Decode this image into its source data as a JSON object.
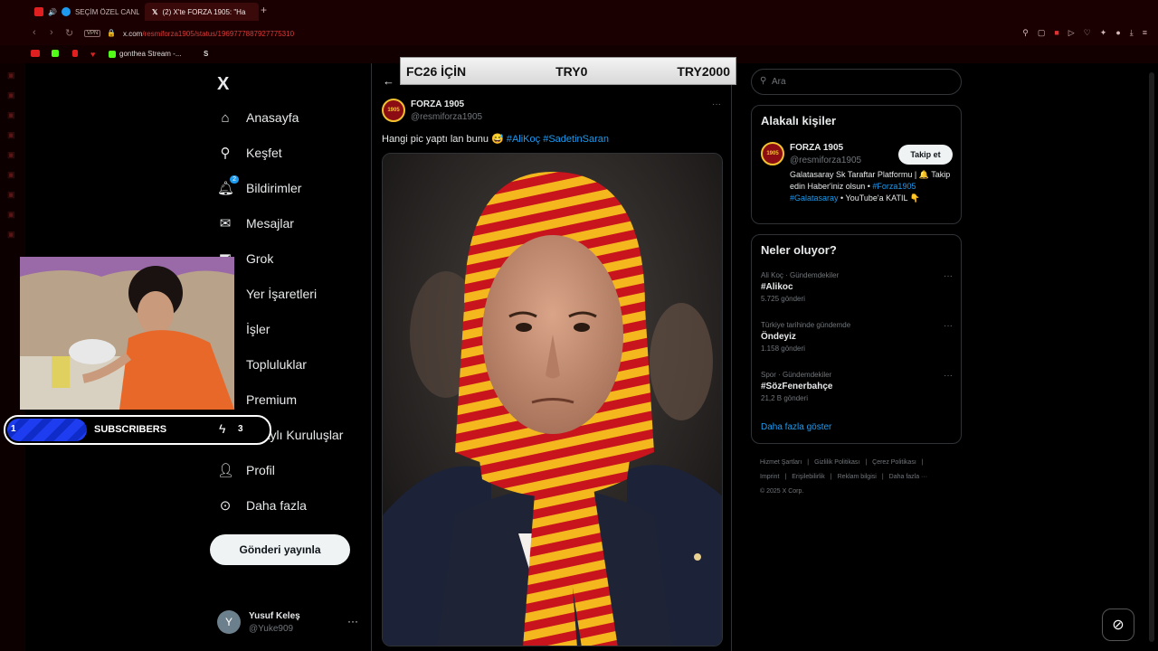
{
  "browser": {
    "tabs": [
      {
        "label": "SEÇİM ÖZEL CANLI"
      },
      {
        "label": "(2) X'te FORZA 1905: \"Ha"
      }
    ],
    "new_tab": "+",
    "vpn": "VPN",
    "url_host": "x.com",
    "url_path": "/resmiforza1905/status/1969777887927775310",
    "bookmarks": [
      {
        "label": ""
      },
      {
        "label": ""
      },
      {
        "label": ""
      },
      {
        "label": ""
      },
      {
        "label": "gonthea Stream -..."
      },
      {
        "label": "S"
      }
    ]
  },
  "banner": {
    "left": "FC26 İÇİN",
    "middle": "TRY0",
    "right": "TRY2000"
  },
  "subscribers": {
    "current": "1",
    "label": "SUBSCRIBERS",
    "goal": "3"
  },
  "nav": {
    "logo": "X",
    "items": [
      {
        "label": "Anasayfa",
        "icon": "home-icon"
      },
      {
        "label": "Keşfet",
        "icon": "search-icon"
      },
      {
        "label": "Bildirimler",
        "icon": "bell-icon",
        "badge": "2"
      },
      {
        "label": "Mesajlar",
        "icon": "mail-icon"
      },
      {
        "label": "Grok",
        "icon": "grok-icon"
      },
      {
        "label": "Yer İşaretleri",
        "icon": "bookmark-icon"
      },
      {
        "label": "İşler",
        "icon": "briefcase-icon"
      },
      {
        "label": "Topluluklar",
        "icon": "people-icon"
      },
      {
        "label": "Premium",
        "icon": "x-icon"
      },
      {
        "label": "Onaylı Kuruluşlar",
        "icon": "lightning-icon"
      },
      {
        "label": "Profil",
        "icon": "person-icon"
      },
      {
        "label": "Daha fazla",
        "icon": "more-circle-icon"
      }
    ],
    "post_button": "Gönderi yayınla",
    "user": {
      "initial": "Y",
      "name": "Yusuf Keleş",
      "handle": "@Yuke909"
    }
  },
  "post": {
    "author": "FORZA 1905",
    "handle": "@resmiforza1905",
    "text": "Hangi pic yaptı lan bunu 😅",
    "hashtags": [
      "#AliKoç",
      "#SadetinSaran"
    ]
  },
  "search": {
    "placeholder": "Ara"
  },
  "related": {
    "title": "Alakalı kişiler",
    "name": "FORZA 1905",
    "handle": "@resmiforza1905",
    "follow": "Takip et",
    "bio_1": "Galatasaray Sk Taraftar Platformu | 🔔 Takip edin Haber'iniz olsun • ",
    "bio_tags": "#Forza1905 #Galatasaray",
    "bio_2": " • YouTube'a KATIL 👇"
  },
  "trends": {
    "title": "Neler oluyor?",
    "items": [
      {
        "meta": "Ali Koç · Gündemdekiler",
        "name": "#Alikoc",
        "count": "5.725 gönderi"
      },
      {
        "meta": "Türkiye tarihinde gündemde",
        "name": "Öndeyiz",
        "count": "1.158 gönderi"
      },
      {
        "meta": "Spor · Gündemdekiler",
        "name": "#SözFenerbahçe",
        "count": "21,2 B gönderi"
      }
    ],
    "show_more": "Daha fazla göster"
  },
  "footer": {
    "links": [
      "Hizmet Şartları",
      "|",
      "Gizlilik Politikası",
      "|",
      "Çerez Politikası",
      "|",
      "Imprint",
      "|",
      "Erişilebilirlik",
      "|",
      "Reklam bilgisi",
      "|",
      "Daha fazla ···"
    ],
    "copyright": "© 2025 X Corp."
  }
}
